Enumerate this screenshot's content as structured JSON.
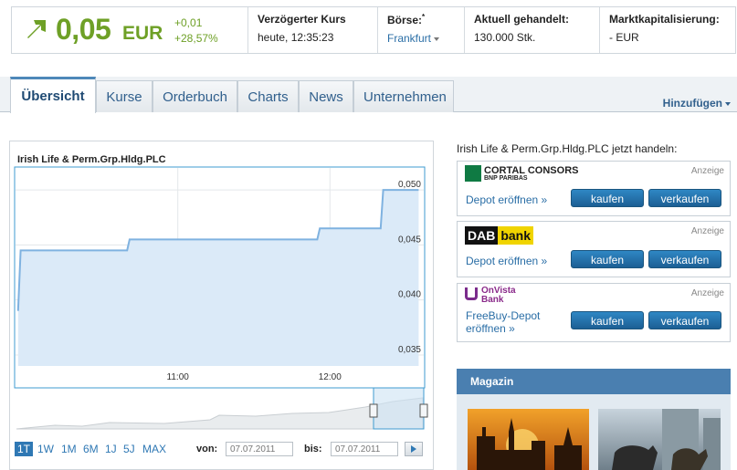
{
  "quote": {
    "price": "0,05",
    "currency": "EUR",
    "change_abs": "+0,01",
    "change_pct": "+28,57%",
    "delayed": {
      "label": "Verzögerter Kurs",
      "value": "heute, 12:35:23"
    },
    "exchange": {
      "label": "Börse:",
      "marker": "*",
      "value": "Frankfurt"
    },
    "volume": {
      "label": "Aktuell gehandelt:",
      "value": "130.000 Stk."
    },
    "market_cap": {
      "label": "Marktkapitalisierung:",
      "value": "- EUR"
    }
  },
  "tabs": [
    {
      "label": "Übersicht",
      "active": true
    },
    {
      "label": "Kurse"
    },
    {
      "label": "Orderbuch"
    },
    {
      "label": "Charts"
    },
    {
      "label": "News"
    },
    {
      "label": "Unternehmen"
    }
  ],
  "add_label": "Hinzufügen",
  "chart_panel": {
    "title": "Irish Life & Perm.Grp.Hldg.PLC",
    "ranges": [
      "1T",
      "1W",
      "1M",
      "6M",
      "1J",
      "5J",
      "MAX"
    ],
    "active_range": "1T",
    "from_label": "von:",
    "to_label": "bis:",
    "from_date": "07.07.2011",
    "to_date": "07.07.2011"
  },
  "chart_data": {
    "type": "area",
    "title": "Irish Life & Perm.Grp.Hldg.PLC",
    "xlabel": "",
    "ylabel": "",
    "x_ticks": [
      "11:00",
      "12:00"
    ],
    "y_ticks": [
      "0,050",
      "0,045",
      "0,040",
      "0,035"
    ],
    "ylim": [
      0.034,
      0.052
    ],
    "grid": true,
    "series": [
      {
        "x": [
          "09:57",
          "09:58",
          "10:40",
          "10:41",
          "11:55",
          "11:56",
          "12:20",
          "12:21",
          "12:35"
        ],
        "values": [
          0.039,
          0.0445,
          0.0445,
          0.0455,
          0.0455,
          0.0465,
          0.0465,
          0.05,
          0.05
        ]
      }
    ]
  },
  "trade": {
    "heading": "Irish Life & Perm.Grp.Hldg.PLC jetzt handeln:",
    "brokers": [
      {
        "logo": "CORTAL CONSORS",
        "logo_sub": "BNP PARIBAS",
        "ad": "Anzeige",
        "link": "Depot eröffnen »",
        "buy": "kaufen",
        "sell": "verkaufen"
      },
      {
        "logo_a": "DAB",
        "logo_b": "bank",
        "ad": "Anzeige",
        "link": "Depot eröffnen »",
        "buy": "kaufen",
        "sell": "verkaufen"
      },
      {
        "logo": "OnVista",
        "logo_sub": "Bank",
        "ad": "Anzeige",
        "link_line1": "FreeBuy-Depot",
        "link_line2": "eröffnen »",
        "buy": "kaufen",
        "sell": "verkaufen"
      }
    ]
  },
  "magazin": {
    "title": "Magazin"
  },
  "colors": {
    "accent": "#6ea026",
    "link": "#2a6ea6",
    "chart_line": "#7fb2e0",
    "chart_fill": "#dbeaf8"
  },
  "icons": {
    "trend": "arrow-up-right-icon"
  }
}
